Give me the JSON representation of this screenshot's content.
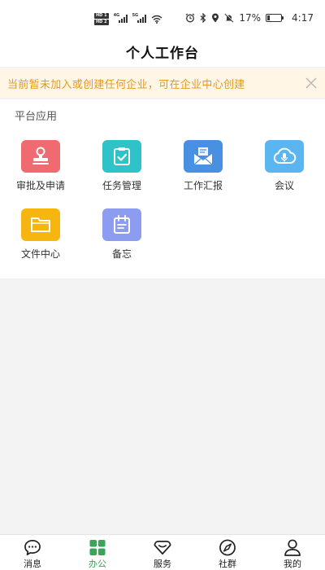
{
  "status_bar": {
    "sim1": "HD 1",
    "sim2": "HD 2",
    "net1": "4G",
    "net2": "5G",
    "battery_percent": "17%",
    "battery_level": 0.17,
    "time": "4:17"
  },
  "header": {
    "title": "个人工作台"
  },
  "notice": {
    "text": "当前暂未加入或创建任何企业，可在企业中心创建"
  },
  "apps": {
    "section_title": "平台应用",
    "items": [
      {
        "label": "审批及申请",
        "icon": "stamp-icon",
        "color": "#ef6a71"
      },
      {
        "label": "任务管理",
        "icon": "task-check-icon",
        "color": "#2fc2c8"
      },
      {
        "label": "工作汇报",
        "icon": "envelope-icon",
        "color": "#4a90e2"
      },
      {
        "label": "会议",
        "icon": "cloud-mic-icon",
        "color": "#5bb5f0"
      },
      {
        "label": "文件中心",
        "icon": "folder-icon",
        "color": "#f6b60f"
      },
      {
        "label": "备忘",
        "icon": "memo-icon",
        "color": "#8c9cf0"
      }
    ]
  },
  "bottom_nav": {
    "active_color": "#3aa55a",
    "items": [
      {
        "label": "消息",
        "icon": "chat-bubble-icon"
      },
      {
        "label": "办公",
        "icon": "grid-icon",
        "active": true
      },
      {
        "label": "服务",
        "icon": "diamond-icon"
      },
      {
        "label": "社群",
        "icon": "compass-icon"
      },
      {
        "label": "我的",
        "icon": "person-icon"
      }
    ]
  }
}
